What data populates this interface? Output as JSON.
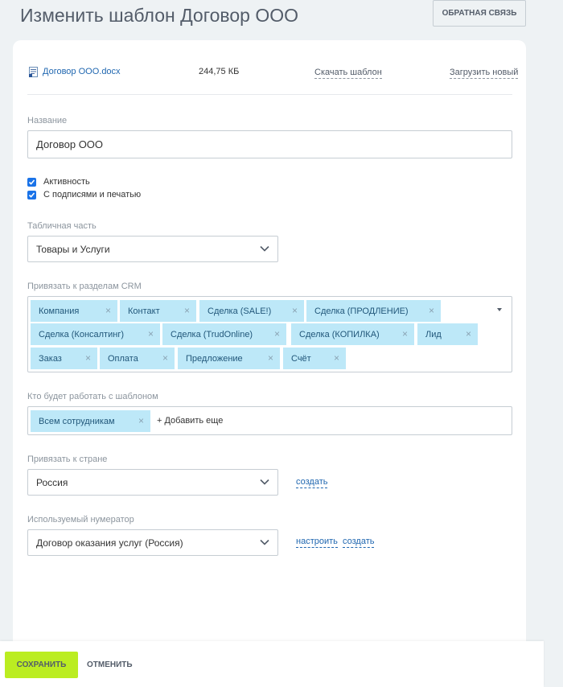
{
  "header": {
    "title": "Изменить шаблон Договор ООО",
    "feedback_label": "ОБРАТНАЯ СВЯЗЬ"
  },
  "file": {
    "name": "Договор ООО.docx",
    "size": "244,75 КБ",
    "download_label": "Скачать шаблон",
    "upload_label": "Загрузить новый"
  },
  "name_field": {
    "label": "Название",
    "value": "Договор ООО"
  },
  "checkboxes": [
    {
      "label": "Активность",
      "checked": true
    },
    {
      "label": "С подписями и печатью",
      "checked": true
    }
  ],
  "table_part": {
    "label": "Табличная часть",
    "value": "Товары и Услуги"
  },
  "crm": {
    "label": "Привязать к разделам CRM",
    "tags": [
      "Компания",
      "Контакт",
      "Сделка (SALE!)",
      "Сделка (ПРОДЛЕНИЕ)",
      "Сделка (Консалтинг)",
      "Сделка (TrudOnline)",
      "Сделка (КОПИЛКА)",
      "Лид",
      "Заказ",
      "Оплата",
      "Предложение",
      "Счёт"
    ]
  },
  "users": {
    "label": "Кто будет работать с шаблоном",
    "tag": "Всем сотрудникам",
    "add_more": "+ Добавить еще"
  },
  "country": {
    "label": "Привязать к стране",
    "value": "Россия",
    "create_link": "создать"
  },
  "numerator": {
    "label": "Используемый нумератор",
    "value": "Договор оказания услуг (Россия)",
    "configure_link": "настроить",
    "create_link": "создать"
  },
  "footer": {
    "save_label": "СОХРАНИТЬ",
    "cancel_label": "ОТМЕНИТЬ"
  },
  "colors": {
    "accent": "#bbed21",
    "tag_bg": "#bde8f8",
    "link": "#2067b0",
    "checkbox": "#1a73e8"
  }
}
